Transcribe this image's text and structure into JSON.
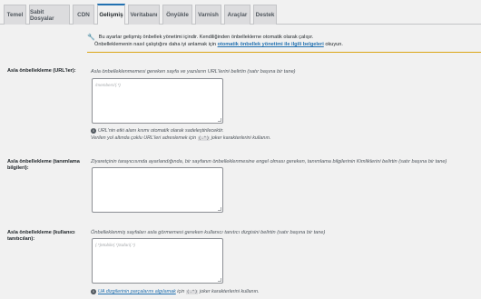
{
  "tabs": [
    {
      "label": "Temel"
    },
    {
      "label": "Sabit Dosyalar"
    },
    {
      "label": "CDN"
    },
    {
      "label": "Gelişmiş"
    },
    {
      "label": "Veritabanı"
    },
    {
      "label": "Önyükle"
    },
    {
      "label": "Varnish"
    },
    {
      "label": "Araçlar"
    },
    {
      "label": "Destek"
    }
  ],
  "active_tab": "Gelişmiş",
  "notice": {
    "line1": "Bu ayarlar gelişmiş önbellek yönetimi içindir. Kendiliğinden önbelleklerne otomatik olarak çalışır.",
    "line2_prefix": "Önbelleklemenin nasıl çalıştığını daha iyi anlamak için",
    "line2_link": "otomatik önbellek yönetimi ile ilgili belgeleri",
    "line2_suffix": "okuyun."
  },
  "fields": [
    {
      "label": "Asla önbellekleme (URL'ler):",
      "description": "Asla önbelleklenmemesi gereken sayfa ve yazıların URL'lerini belirtin (satır başına bir tane)",
      "placeholder": "/members/(.*)",
      "hint_line1": "URL'nin etki alanı kısmı otomatik olarak sadeleştirilecektir.",
      "hint_line2_prefix": "Verilen yol altında çoklu URL'leri adreslemek için",
      "hint_code": "(.*)",
      "hint_line2_suffix": "joker karakterlerini kullanın."
    },
    {
      "label": "Asla önbellekleme (tanımlama bilgileri):",
      "description": "Ziyaretçinin tarayıcısında ayarlandığında, bir sayfanın önbelleklenmesine engel olması gereken, tanımlama bilgilerinin Kimliklerini belirtin (satır başına bir tane)",
      "placeholder": ""
    },
    {
      "label": "Asla önbellekleme (kullanıcı tanıtıcıları):",
      "description": "Önbelleklenmiş sayfaları asla görmemesi gereken kullanıcı tanıtıcı dizgisini belirtin (satır başına bir tane)",
      "placeholder": "(.*)Mobile(.*)Safari(.*)",
      "hint_link": "UA dizgilerinin parçalarını algılamak",
      "hint_mid": "için",
      "hint_code": "(.*)",
      "hint_suffix": "joker karakterlerini kullanın."
    }
  ],
  "colors": {
    "accent": "#2271b1",
    "warning": "#dba617"
  }
}
